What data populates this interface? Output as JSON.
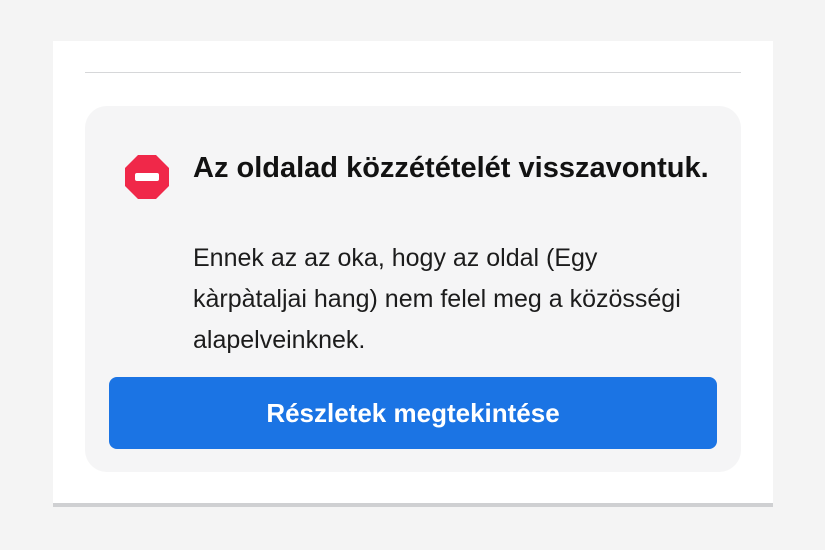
{
  "notice": {
    "icon": "stop-icon",
    "title": "Az oldalad közzétételét visszavontuk.",
    "message": "Ennek az az oka, hogy az oldal (Egy kàrpàtaljai hang) nem felel meg a közösségi alapelveinknek.",
    "button_label": "Részletek megtekintése"
  },
  "colors": {
    "accent": "#1b74e4",
    "stop_icon": "#f02849",
    "notice_background": "#f5f5f6"
  }
}
